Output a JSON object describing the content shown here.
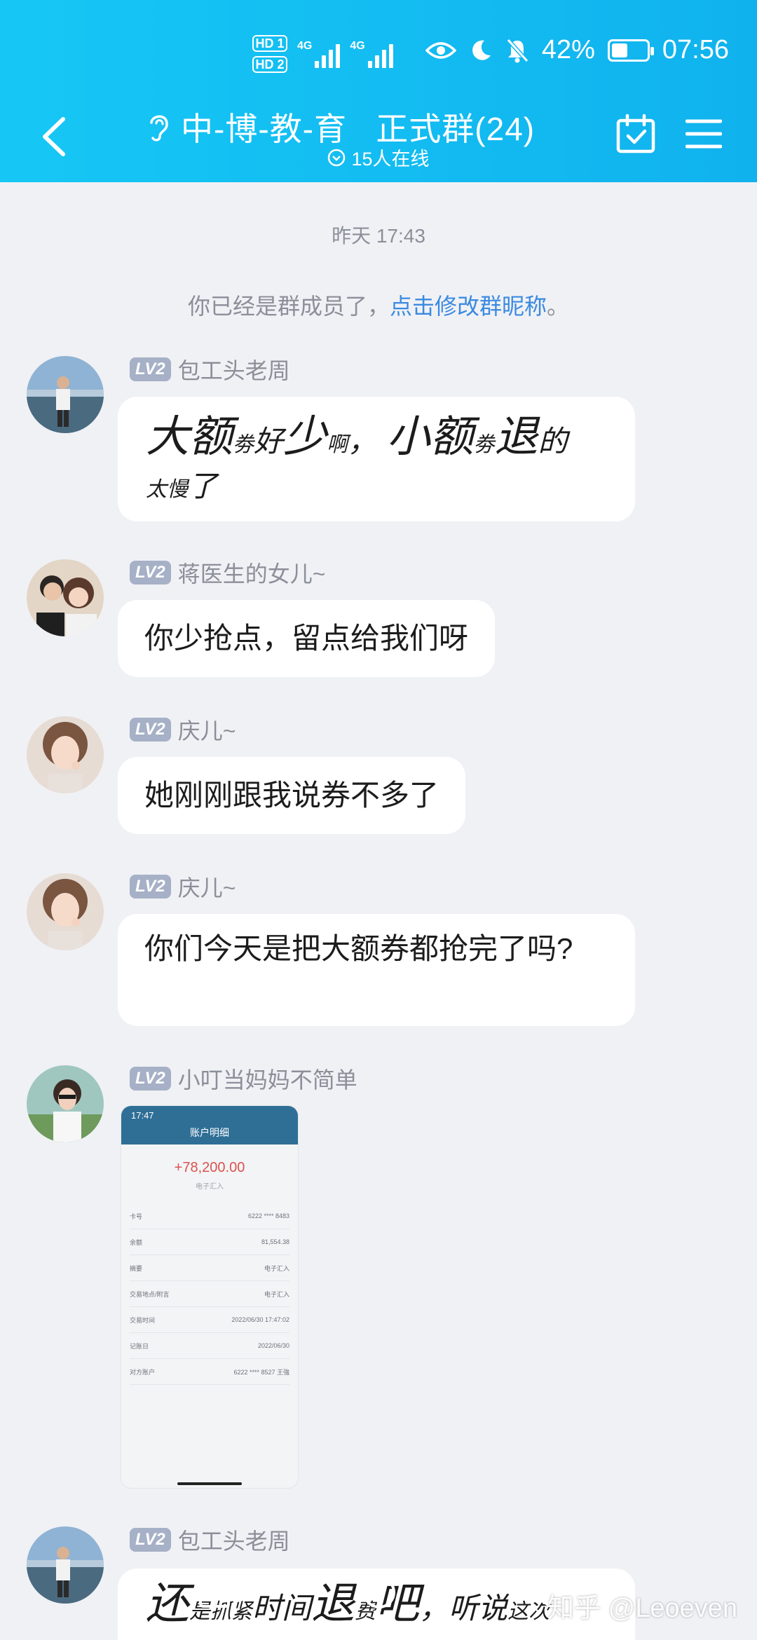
{
  "status_bar": {
    "hd1": "HD 1",
    "hd2": "HD 2",
    "net1": "4G",
    "net2": "4G",
    "battery": "42%",
    "time": "07:56"
  },
  "header": {
    "title": "中-博-教-育   正式群(24)",
    "online": "15人在线",
    "accent": "#12bbf2"
  },
  "chat": {
    "time_separator": "昨天 17:43",
    "notice_text": "你已经是群成员了，",
    "notice_link": "点击修改群昵称",
    "notice_end": "。",
    "messages": [
      {
        "level": "LV2",
        "sender": "包工头老周",
        "handwriting": [
          "大",
          "额",
          "劵",
          "好",
          "少",
          "啊",
          "，",
          "小",
          "额",
          "劵",
          "退",
          "的",
          "太",
          "慢",
          "了"
        ]
      },
      {
        "level": "LV2",
        "sender": "蒋医生的女儿~",
        "text": "你少抢点，留点给我们呀"
      },
      {
        "level": "LV2",
        "sender": "庆儿~",
        "text": "她刚刚跟我说券不多了"
      },
      {
        "level": "LV2",
        "sender": "庆儿~",
        "text": "你们今天是把大额券都抢完了吗?"
      },
      {
        "level": "LV2",
        "sender": "小叮当妈妈不简单",
        "image": {
          "time": "17:47",
          "title": "账户明细",
          "amount": "+78,200.00",
          "sub": "电子汇入",
          "rows": [
            [
              "卡号",
              "6222 **** 8483"
            ],
            [
              "余额",
              "81,554.38"
            ],
            [
              "摘要",
              "电子汇入"
            ],
            [
              "交易地点/附言",
              "电子汇入"
            ],
            [
              "交易时间",
              "2022/06/30 17:47:02"
            ],
            [
              "记账日",
              "2022/06/30"
            ],
            [
              "对方账户",
              "6222 **** 8527 王強"
            ]
          ]
        }
      },
      {
        "level": "LV2",
        "sender": "包工头老周",
        "handwriting": [
          "还",
          "是",
          "抓",
          "紧",
          "时",
          "间",
          "退",
          "费",
          "吧",
          "，",
          "听",
          "说",
          "这",
          "次"
        ]
      }
    ]
  },
  "watermark": "知乎 @Leoeven"
}
